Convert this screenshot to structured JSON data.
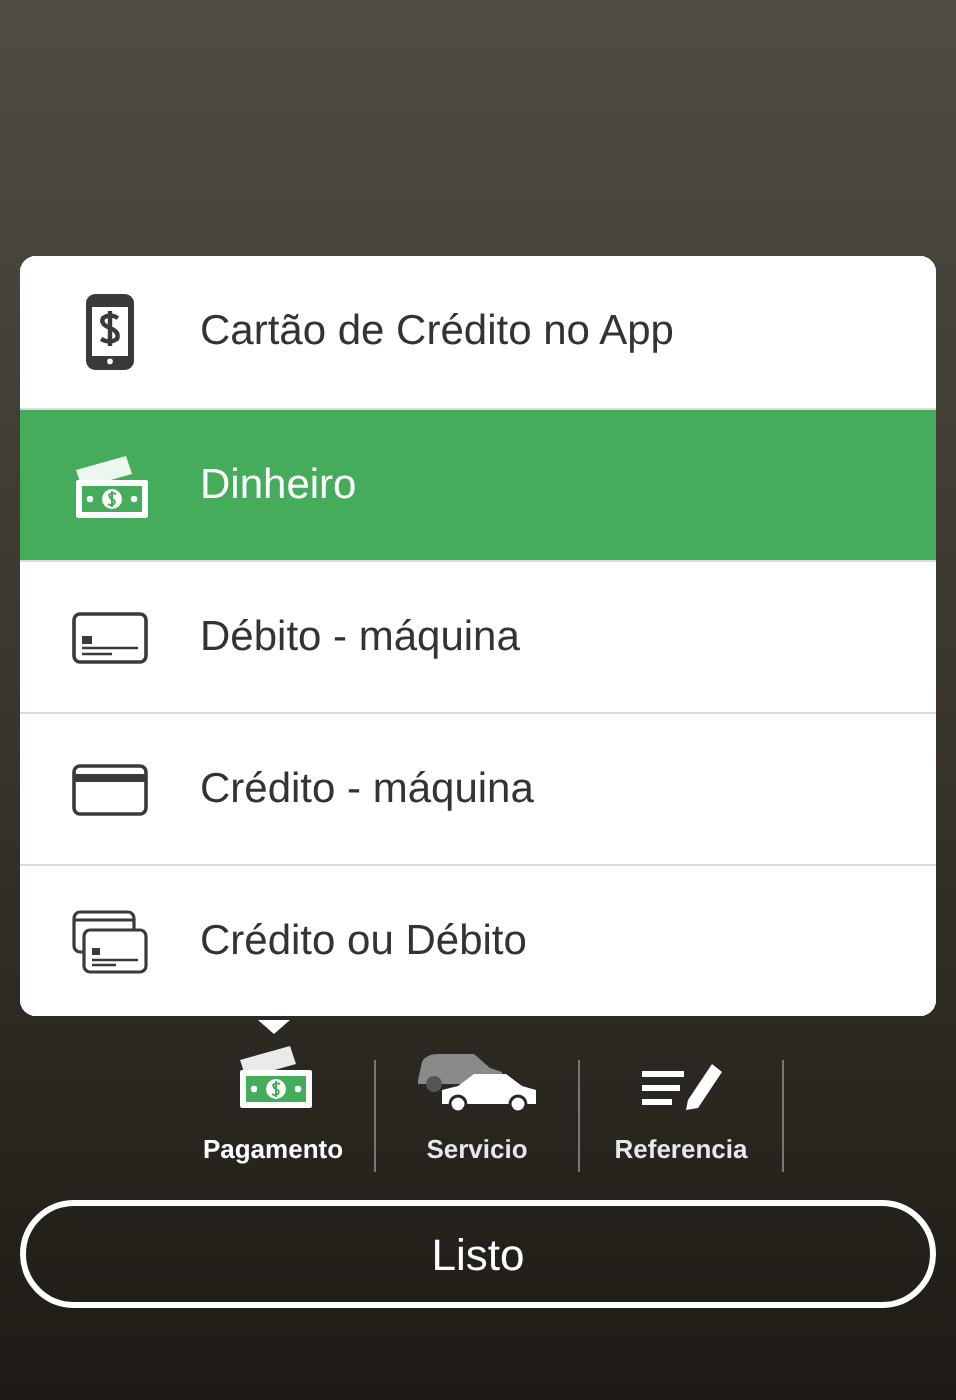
{
  "payment_menu": {
    "options": [
      {
        "label": "Cartão de Crédito no App",
        "kind": "phone",
        "selected": false
      },
      {
        "label": "Dinheiro",
        "kind": "cash",
        "selected": true
      },
      {
        "label": "Débito - máquina",
        "kind": "card_lines",
        "selected": false
      },
      {
        "label": "Crédito - máquina",
        "kind": "card",
        "selected": false
      },
      {
        "label": "Crédito ou Débito",
        "kind": "cards",
        "selected": false
      }
    ]
  },
  "tabs": [
    {
      "label": "Pagamento",
      "kind": "cash",
      "selected": true
    },
    {
      "label": "Servicio",
      "kind": "cars",
      "selected": false
    },
    {
      "label": "Referencia",
      "kind": "note",
      "selected": false
    }
  ],
  "done_button": {
    "label": "Listo"
  }
}
